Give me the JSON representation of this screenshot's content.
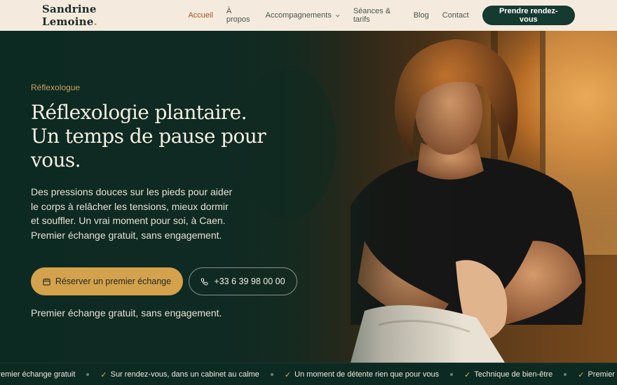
{
  "header": {
    "logo": "Sandrine Lemoine",
    "logo_dot": ".",
    "nav": [
      {
        "label": "Accueil",
        "active": true
      },
      {
        "label": "À propos"
      },
      {
        "label": "Accompagnements",
        "dropdown": true
      },
      {
        "label": "Séances & tarifs"
      },
      {
        "label": "Blog"
      },
      {
        "label": "Contact"
      }
    ],
    "cta": "Prendre rendez-vous"
  },
  "hero": {
    "eyebrow": "Réflexologue",
    "title": "Réflexologie plantaire. Un temps de pause pour vous.",
    "description": "Des pressions douces sur les pieds pour aider le corps à relâcher les tensions, mieux dormir et souffler. Un vrai moment pour soi, à Caen. Premier échange gratuit, sans engagement.",
    "primary_button": "Réserver un premier échange",
    "phone_button": "+33 6 39 98 00 00",
    "note": "Premier échange gratuit, sans engagement."
  },
  "ticker": {
    "items": [
      {
        "text": "Premier échange gratuit",
        "check": false
      },
      {
        "text": "Sur rendez-vous, dans un cabinet au calme",
        "check": true
      },
      {
        "text": "Un moment de détente rien que pour vous",
        "check": true
      },
      {
        "text": "Technique de bien-être",
        "check": true
      },
      {
        "text": "Premier échange gratuit",
        "check": true
      }
    ],
    "check_symbol": "✓"
  },
  "colors": {
    "header_bg": "#f4ebde",
    "hero_bg": "#0e2a22",
    "accent": "#d4a24c",
    "nav_active": "#a0532d",
    "cta_bg": "#153a30"
  }
}
